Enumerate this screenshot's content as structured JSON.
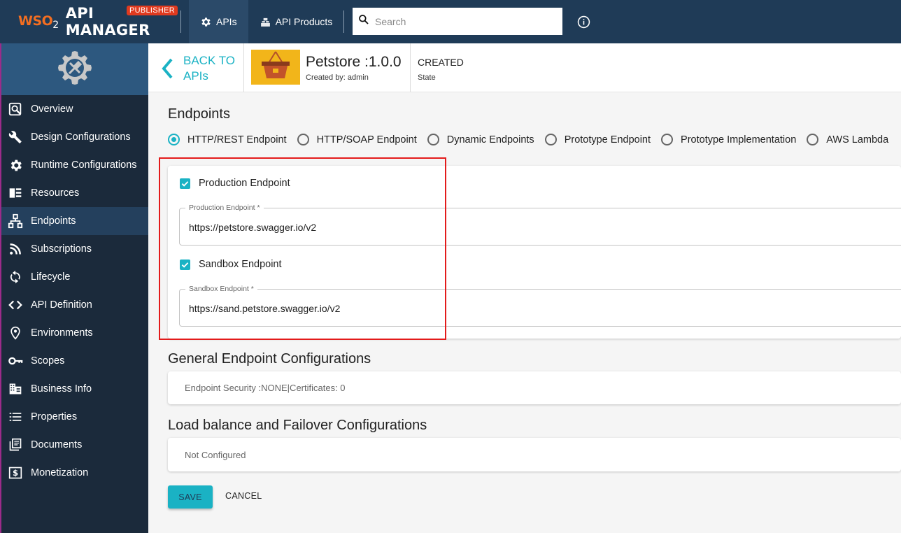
{
  "topbar": {
    "logo_text": "WSO",
    "logo_sub": "2",
    "brand_name": "API MANAGER",
    "badge": "PUBLISHER",
    "nav": [
      {
        "label": "APIs",
        "icon": "gear-icon",
        "active": true
      },
      {
        "label": "API Products",
        "icon": "api-products-icon",
        "active": false
      }
    ],
    "search_placeholder": "Search",
    "info_icon": "info-icon"
  },
  "sidebar": {
    "header_icon": "settings-tools-icon",
    "items": [
      {
        "label": "Overview",
        "icon": "overview-icon"
      },
      {
        "label": "Design Configurations",
        "icon": "wrench-icon"
      },
      {
        "label": "Runtime Configurations",
        "icon": "gear-icon"
      },
      {
        "label": "Resources",
        "icon": "resources-icon"
      },
      {
        "label": "Endpoints",
        "icon": "endpoints-icon",
        "active": true
      },
      {
        "label": "Subscriptions",
        "icon": "rss-icon"
      },
      {
        "label": "Lifecycle",
        "icon": "cycle-icon"
      },
      {
        "label": "API Definition",
        "icon": "code-icon"
      },
      {
        "label": "Environments",
        "icon": "location-pin-icon"
      },
      {
        "label": "Scopes",
        "icon": "key-icon"
      },
      {
        "label": "Business Info",
        "icon": "building-icon"
      },
      {
        "label": "Properties",
        "icon": "list-icon"
      },
      {
        "label": "Documents",
        "icon": "documents-icon"
      },
      {
        "label": "Monetization",
        "icon": "dollar-icon"
      }
    ]
  },
  "header": {
    "back_label": "BACK TO APIs",
    "api_name": "Petstore :1.0.0",
    "created_by": "Created by: admin",
    "state_value": "CREATED",
    "state_label": "State"
  },
  "endpoints": {
    "title": "Endpoints",
    "types": [
      {
        "label": "HTTP/REST Endpoint",
        "selected": true
      },
      {
        "label": "HTTP/SOAP Endpoint",
        "selected": false
      },
      {
        "label": "Dynamic Endpoints",
        "selected": false
      },
      {
        "label": "Prototype Endpoint",
        "selected": false
      },
      {
        "label": "Prototype Implementation",
        "selected": false
      },
      {
        "label": "AWS Lambda",
        "selected": false
      }
    ],
    "production": {
      "checkbox_label": "Production Endpoint",
      "checked": true,
      "field_label": "Production Endpoint *",
      "value": "https://petstore.swagger.io/v2"
    },
    "sandbox": {
      "checkbox_label": "Sandbox Endpoint",
      "checked": true,
      "field_label": "Sandbox Endpoint *",
      "value": "https://sand.petstore.swagger.io/v2"
    }
  },
  "general": {
    "title": "General Endpoint Configurations",
    "summary": "Endpoint Security :NONE|Certificates: 0"
  },
  "loadbalance": {
    "title": "Load balance and Failover Configurations",
    "summary": "Not Configured"
  },
  "actions": {
    "save": "SAVE",
    "cancel": "CANCEL"
  },
  "colors": {
    "topbar": "#1f3b57",
    "sidebar": "#1b2a3b",
    "accent": "#1ab2c4",
    "badge": "#e03a1f",
    "highlight": "#e31b1b"
  }
}
